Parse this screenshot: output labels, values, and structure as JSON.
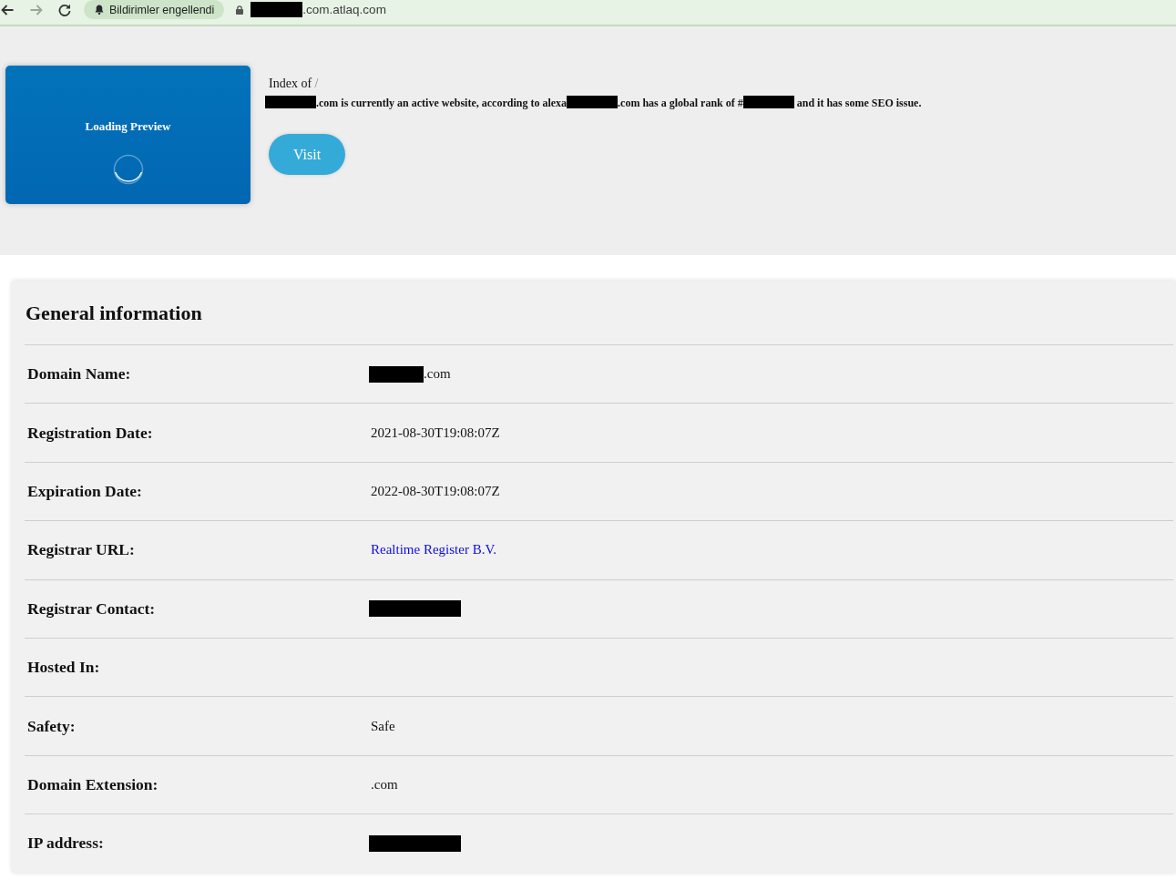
{
  "browser_toolbar": {
    "notification_chip": "Bildirimler engellendi",
    "address": [
      {
        "kind": "redacted"
      },
      {
        "kind": "text",
        "text": ".com.atlaq.com"
      }
    ]
  },
  "preview": {
    "label": "Loading Preview"
  },
  "summary": {
    "index_heading": {
      "label": "Index of",
      "path": "/"
    },
    "description": [
      {
        "kind": "redacted"
      },
      {
        "kind": "text",
        "text": ".com is currently an active website, according to alexa"
      },
      {
        "kind": "redacted"
      },
      {
        "kind": "text",
        "text": ".com has a global rank of #"
      },
      {
        "kind": "redacted"
      },
      {
        "kind": "text",
        "text": " and it has some SEO issue."
      }
    ],
    "visit_button": "Visit"
  },
  "general_information": {
    "title": "General information",
    "rows": [
      {
        "label": "Domain Name:",
        "value": [
          {
            "kind": "redacted"
          },
          {
            "kind": "text",
            "text": ".com"
          }
        ]
      },
      {
        "label": "Registration Date:",
        "value": [
          {
            "kind": "text",
            "text": "2021-08-30T19:08:07Z"
          }
        ]
      },
      {
        "label": "Expiration Date:",
        "value": [
          {
            "kind": "text",
            "text": "2022-08-30T19:08:07Z"
          }
        ]
      },
      {
        "label": "Registrar URL:",
        "value": [
          {
            "kind": "link",
            "text": "Realtime Register B.V."
          }
        ]
      },
      {
        "label": "Registrar Contact:",
        "value": [
          {
            "kind": "redacted"
          }
        ]
      },
      {
        "label": "Hosted In:"
      },
      {
        "label": "Safety:",
        "value": [
          {
            "kind": "text",
            "text": "Safe"
          }
        ]
      },
      {
        "label": "Domain Extension:",
        "value": [
          {
            "kind": "text",
            "text": ".com"
          }
        ]
      },
      {
        "label": "IP address:",
        "value": [
          {
            "kind": "redacted"
          }
        ]
      }
    ]
  }
}
